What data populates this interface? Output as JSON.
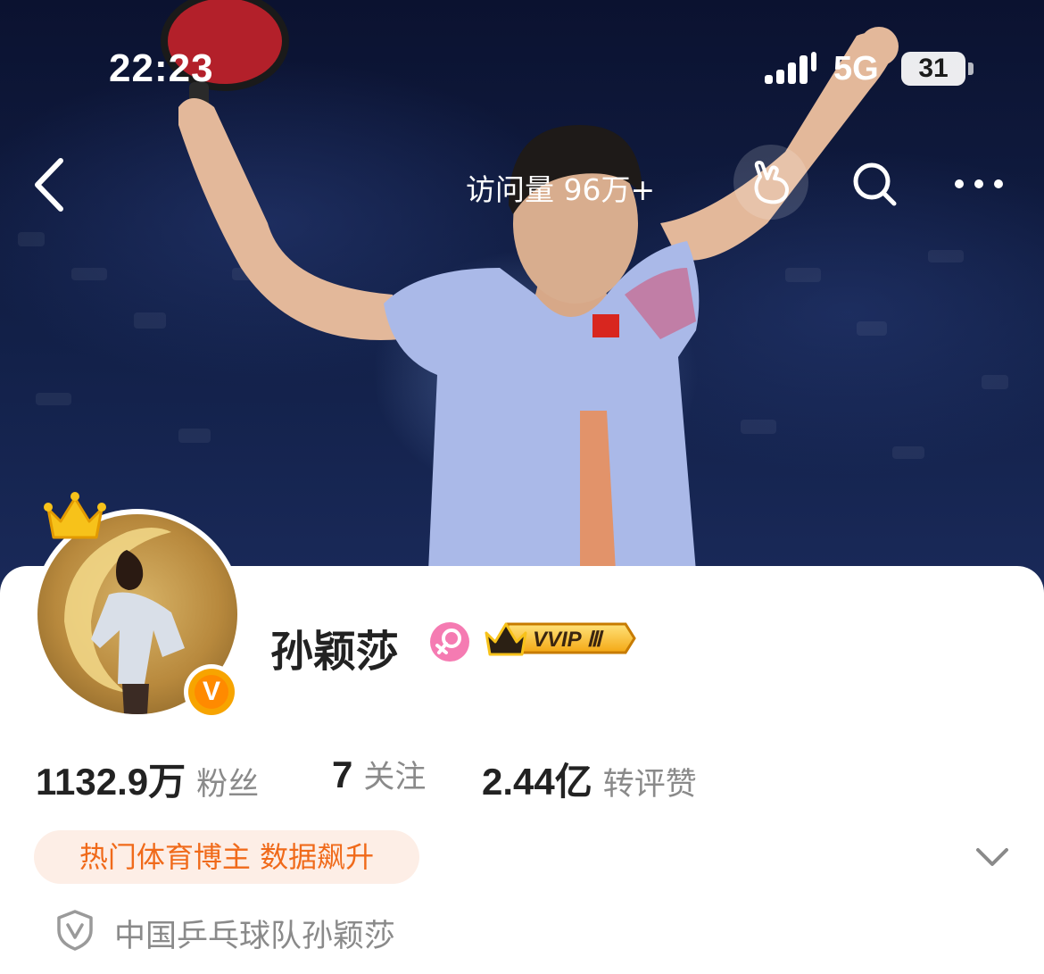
{
  "status_bar": {
    "time": "22:23",
    "network": "5G",
    "battery": "31"
  },
  "nav": {
    "visits_label": "访问量 96万+",
    "back_icon": "chevron-left-icon",
    "poke_icon": "poke-hand-icon",
    "search_icon": "search-icon",
    "more_icon": "more-dots-icon"
  },
  "profile": {
    "name": "孙颖莎",
    "gender_icon": "female-icon",
    "vip_badge": "VVIP Ⅲ",
    "verified_icon": "verified-v-icon",
    "crown_icon": "crown-icon"
  },
  "stats": [
    {
      "value": "1132.9万",
      "label": "粉丝"
    },
    {
      "value": "7",
      "label": "关注"
    },
    {
      "value": "2.44亿",
      "label": "转评赞"
    }
  ],
  "tag": "热门体育博主 数据飙升",
  "certification": "中国乒乓球队孙颖莎",
  "colors": {
    "accent_orange": "#f06a1a",
    "tag_bg": "#fdeee6",
    "gender_pink": "#f57bb2"
  }
}
